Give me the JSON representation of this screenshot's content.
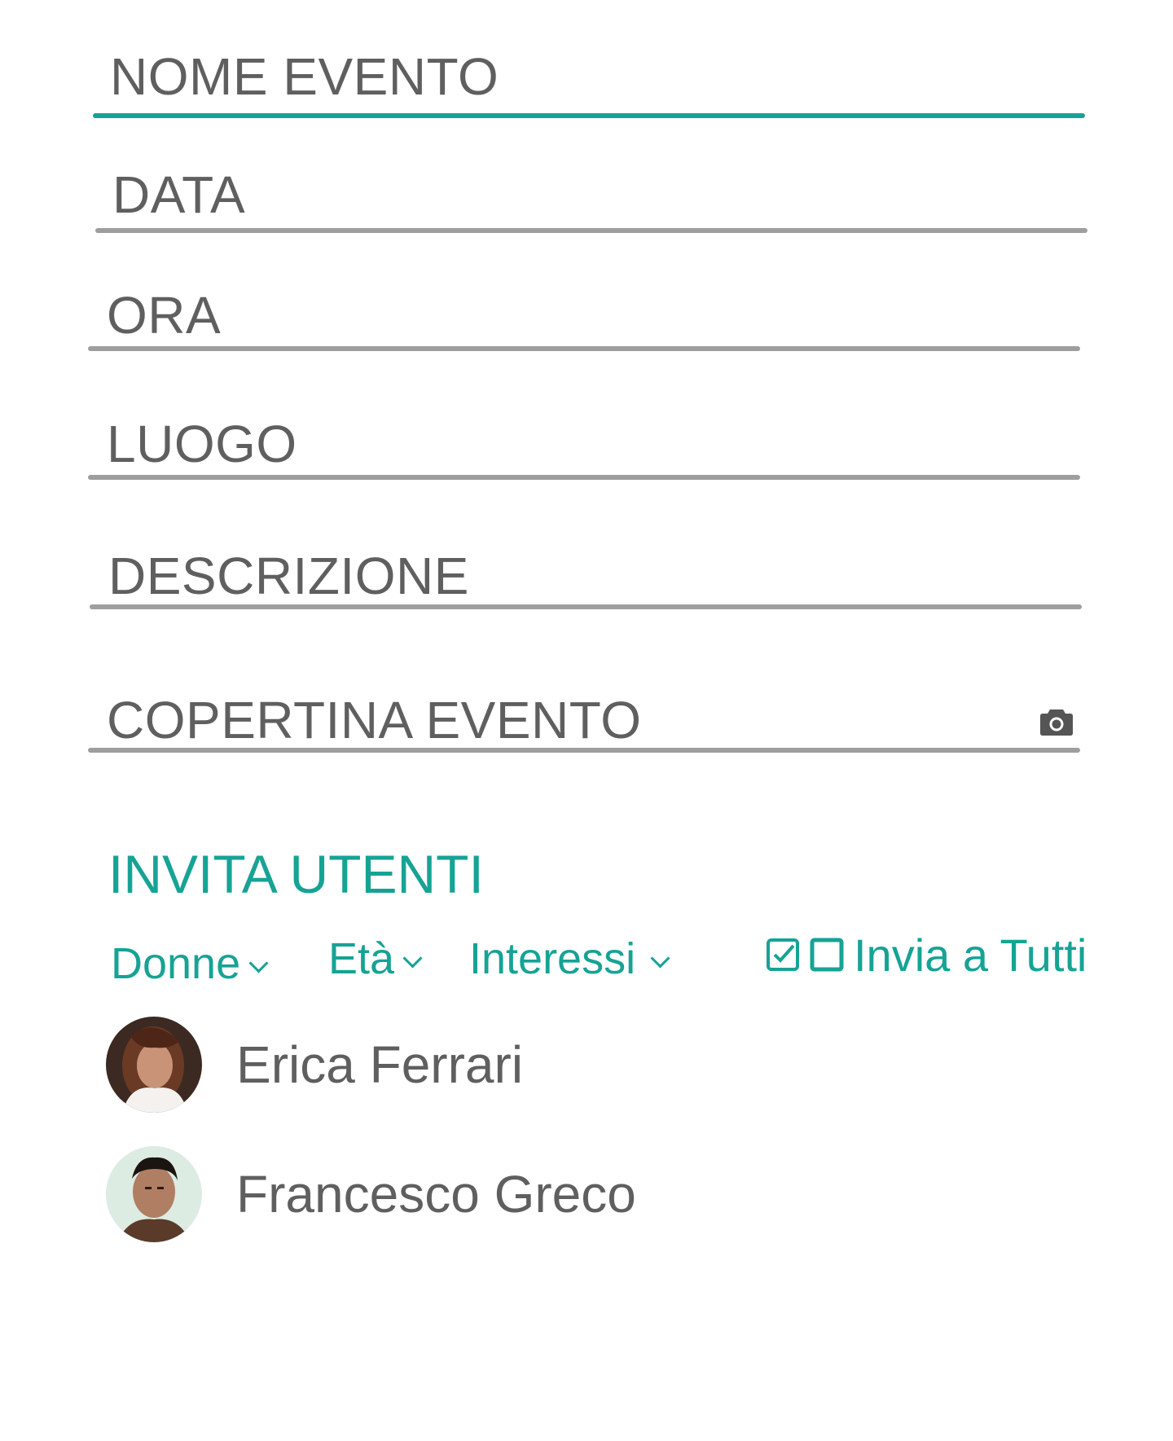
{
  "form": {
    "fields": [
      {
        "placeholder": "NOME EVENTO",
        "focused": true
      },
      {
        "placeholder": "DATA"
      },
      {
        "placeholder": "ORA"
      },
      {
        "placeholder": "LUOGO"
      },
      {
        "placeholder": "DESCRIZIONE"
      },
      {
        "placeholder": "COPERTINA EVENTO",
        "icon": "camera-icon"
      }
    ]
  },
  "invite": {
    "title": "INVITA UTENTI",
    "filters": [
      {
        "label": "Donne",
        "icon": "chevron-down-icon"
      },
      {
        "label": "Età",
        "icon": "chevron-down-icon"
      },
      {
        "label": "Interessi",
        "icon": "chevron-down-icon"
      }
    ],
    "invite_all": {
      "label": "Invia a Tutti",
      "icons": [
        "checkbox-checked-icon",
        "checkbox-empty-icon"
      ]
    },
    "users": [
      {
        "name": "Erica Ferrari",
        "avatar": "avatar-erica"
      },
      {
        "name": "Francesco Greco",
        "avatar": "avatar-francesco"
      }
    ]
  },
  "colors": {
    "accent": "#16a395",
    "text": "#5f5f5f",
    "underline": "#9e9e9e"
  }
}
